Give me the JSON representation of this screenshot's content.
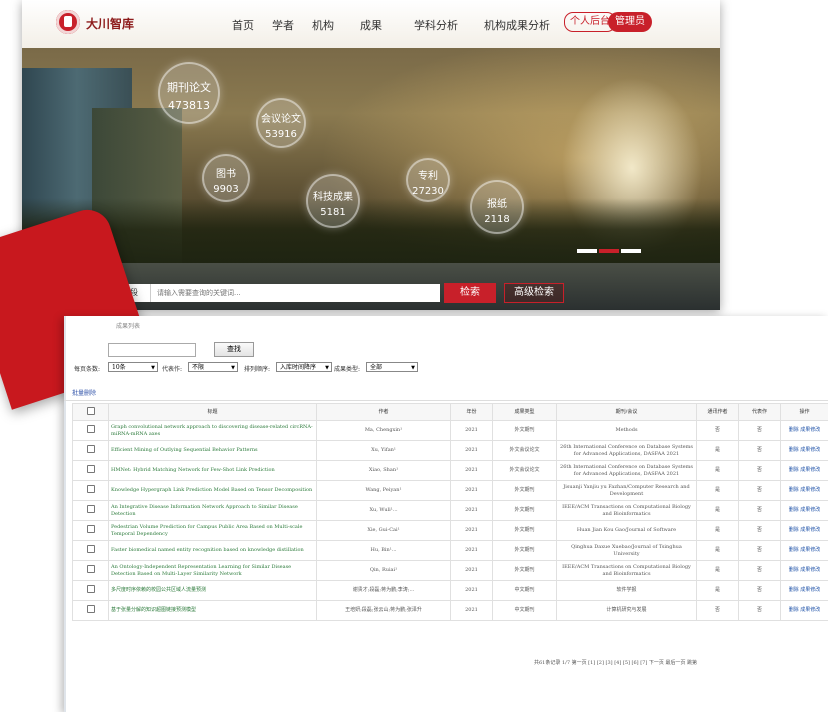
{
  "nav": {
    "logo_text": "大川智库",
    "items": [
      "首页",
      "学者",
      "机构",
      "成果",
      "学科分析",
      "机构成果分析"
    ],
    "personal": "个人后台",
    "admin": "管理员"
  },
  "stats": [
    {
      "label": "期刊论文",
      "value": "473813"
    },
    {
      "label": "会议论文",
      "value": "53916"
    },
    {
      "label": "图书",
      "value": "9903"
    },
    {
      "label": "科技成果",
      "value": "5181"
    },
    {
      "label": "专利",
      "value": "27230"
    },
    {
      "label": "报纸",
      "value": "2118"
    }
  ],
  "search": {
    "field": "全部字段",
    "placeholder": "请输入需要查询的关键词...",
    "button": "检索",
    "advanced": "高级检索"
  },
  "list": {
    "tab_label": "成果列表",
    "find_button": "查找",
    "filters": {
      "page_size_label": "每页条数:",
      "page_size": "10条",
      "rep_label": "代表作:",
      "rep": "不限",
      "sort_label": "排列顺序:",
      "sort": "入库时间降序",
      "type_label": "成果类型:",
      "type": "全部"
    },
    "bulk_delete": "批量删除",
    "columns": [
      "",
      "标题",
      "作者",
      "年份",
      "成果类型",
      "期刊/会议",
      "通讯作者",
      "代表作",
      "操作"
    ],
    "rows": [
      {
        "title": "Graph convolutional network approach to discovering disease-related circRNA-miRNA-mRNA axes",
        "author": "Ma, Chengxin¹",
        "year": "2021",
        "type": "外文期刊",
        "venue": "Methods",
        "corr": "否",
        "rep": "否"
      },
      {
        "title": "Efficient Mining of Outlying Sequential Behavior Patterns",
        "author": "Xu, Yifan¹",
        "year": "2021",
        "type": "外文会议论文",
        "venue": "26th International Conference on Database Systems for Advanced Applications, DASFAA 2021",
        "corr": "是",
        "rep": "否"
      },
      {
        "title": "HMNet: Hybrid Matching Network for Few-Shot Link Prediction",
        "author": "Xiao, Shan¹",
        "year": "2021",
        "type": "外文会议论文",
        "venue": "26th International Conference on Database Systems for Advanced Applications, DASFAA 2021",
        "corr": "是",
        "rep": "否"
      },
      {
        "title": "Knowledge Hypergraph Link Prediction Model Based on Tensor Decomposition",
        "author": "Wang, Peiyan¹",
        "year": "2021",
        "type": "外文期刊",
        "venue": "Jisuanji Yanjiu yu Fazhan/Computer Research and Development",
        "corr": "是",
        "rep": "否"
      },
      {
        "title": "An Integrative Disease Information Network Approach to Similar Disease Detection",
        "author": "Xu, Wuli¹...",
        "year": "2021",
        "type": "外文期刊",
        "venue": "IEEE/ACM Transactions on Computational Biology and Bioinformatics",
        "corr": "是",
        "rep": "否"
      },
      {
        "title": "Pedestrian Volume Prediction for Campus Public Area Based on Multi-scale Temporal Dependency",
        "author": "Xie, Gui-Cai¹",
        "year": "2021",
        "type": "外文期刊",
        "venue": "Huan Jian Kou Gao/Journal of Software",
        "corr": "是",
        "rep": "否"
      },
      {
        "title": "Faster biomedical named entity recognition based on knowledge distillation",
        "author": "Hu, Bin¹...",
        "year": "2021",
        "type": "外文期刊",
        "venue": "Qinghua Daxue Xuebao/Journal of Tsinghua University",
        "corr": "是",
        "rep": "否"
      },
      {
        "title": "An Ontology-Independent Representation Learning for Similar Disease Detection Based on Multi-Layer Similarity Network",
        "author": "Qin, Ruiai¹",
        "year": "2021",
        "type": "外文期刊",
        "venue": "IEEE/ACM Transactions on Computational Biology and Bioinformatics",
        "corr": "是",
        "rep": "否"
      },
      {
        "title": "多尺度时序依赖的校园公共区域人流量预测",
        "author": "谢贵才;段磊;蒋为鹏;李涛;...",
        "year": "2021",
        "type": "中文期刊",
        "venue": "软件学报",
        "corr": "是",
        "rep": "否"
      },
      {
        "title": "基于张量分解的知识超图链接预测模型",
        "author": "王培妍;段磊;张云山;蒋为鹏;张泽升",
        "year": "2021",
        "type": "中文期刊",
        "venue": "计算机研究与发展",
        "corr": "否",
        "rep": "否"
      }
    ],
    "op_delete": "删除",
    "op_edit": "成果修改",
    "pager": "共61条记录 1/7 第一页 [1] [2] [3] [4] [5] [6] [7] 下一页 最后一页 跳第"
  }
}
